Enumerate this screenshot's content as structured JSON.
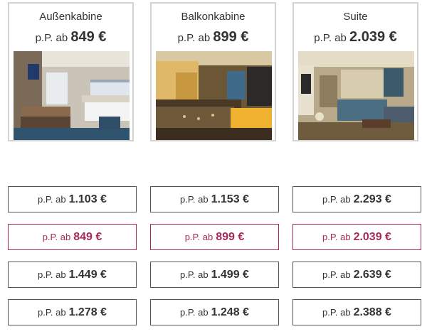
{
  "cabins": [
    {
      "name": "Außenkabine",
      "price_prefix": "p.P. ab",
      "price": "849 €",
      "photo": "outside-cabin-photo"
    },
    {
      "name": "Balkonkabine",
      "price_prefix": "p.P. ab",
      "price": "899 €",
      "photo": "balcony-cabin-photo"
    },
    {
      "name": "Suite",
      "price_prefix": "p.P. ab",
      "price": "2.039 €",
      "photo": "suite-photo"
    }
  ],
  "price_prefix": "p.P. ab",
  "price_rows": [
    [
      "1.103 €",
      "1.153 €",
      "2.293 €"
    ],
    [
      "849 €",
      "899 €",
      "2.039 €"
    ],
    [
      "1.449 €",
      "1.499 €",
      "2.639 €"
    ],
    [
      "1.278 €",
      "1.248 €",
      "2.388 €"
    ]
  ],
  "selected_row_index": 1,
  "colors": {
    "selected": "#a8295a",
    "card_border": "#d3d3d3",
    "box_border": "#555555"
  }
}
